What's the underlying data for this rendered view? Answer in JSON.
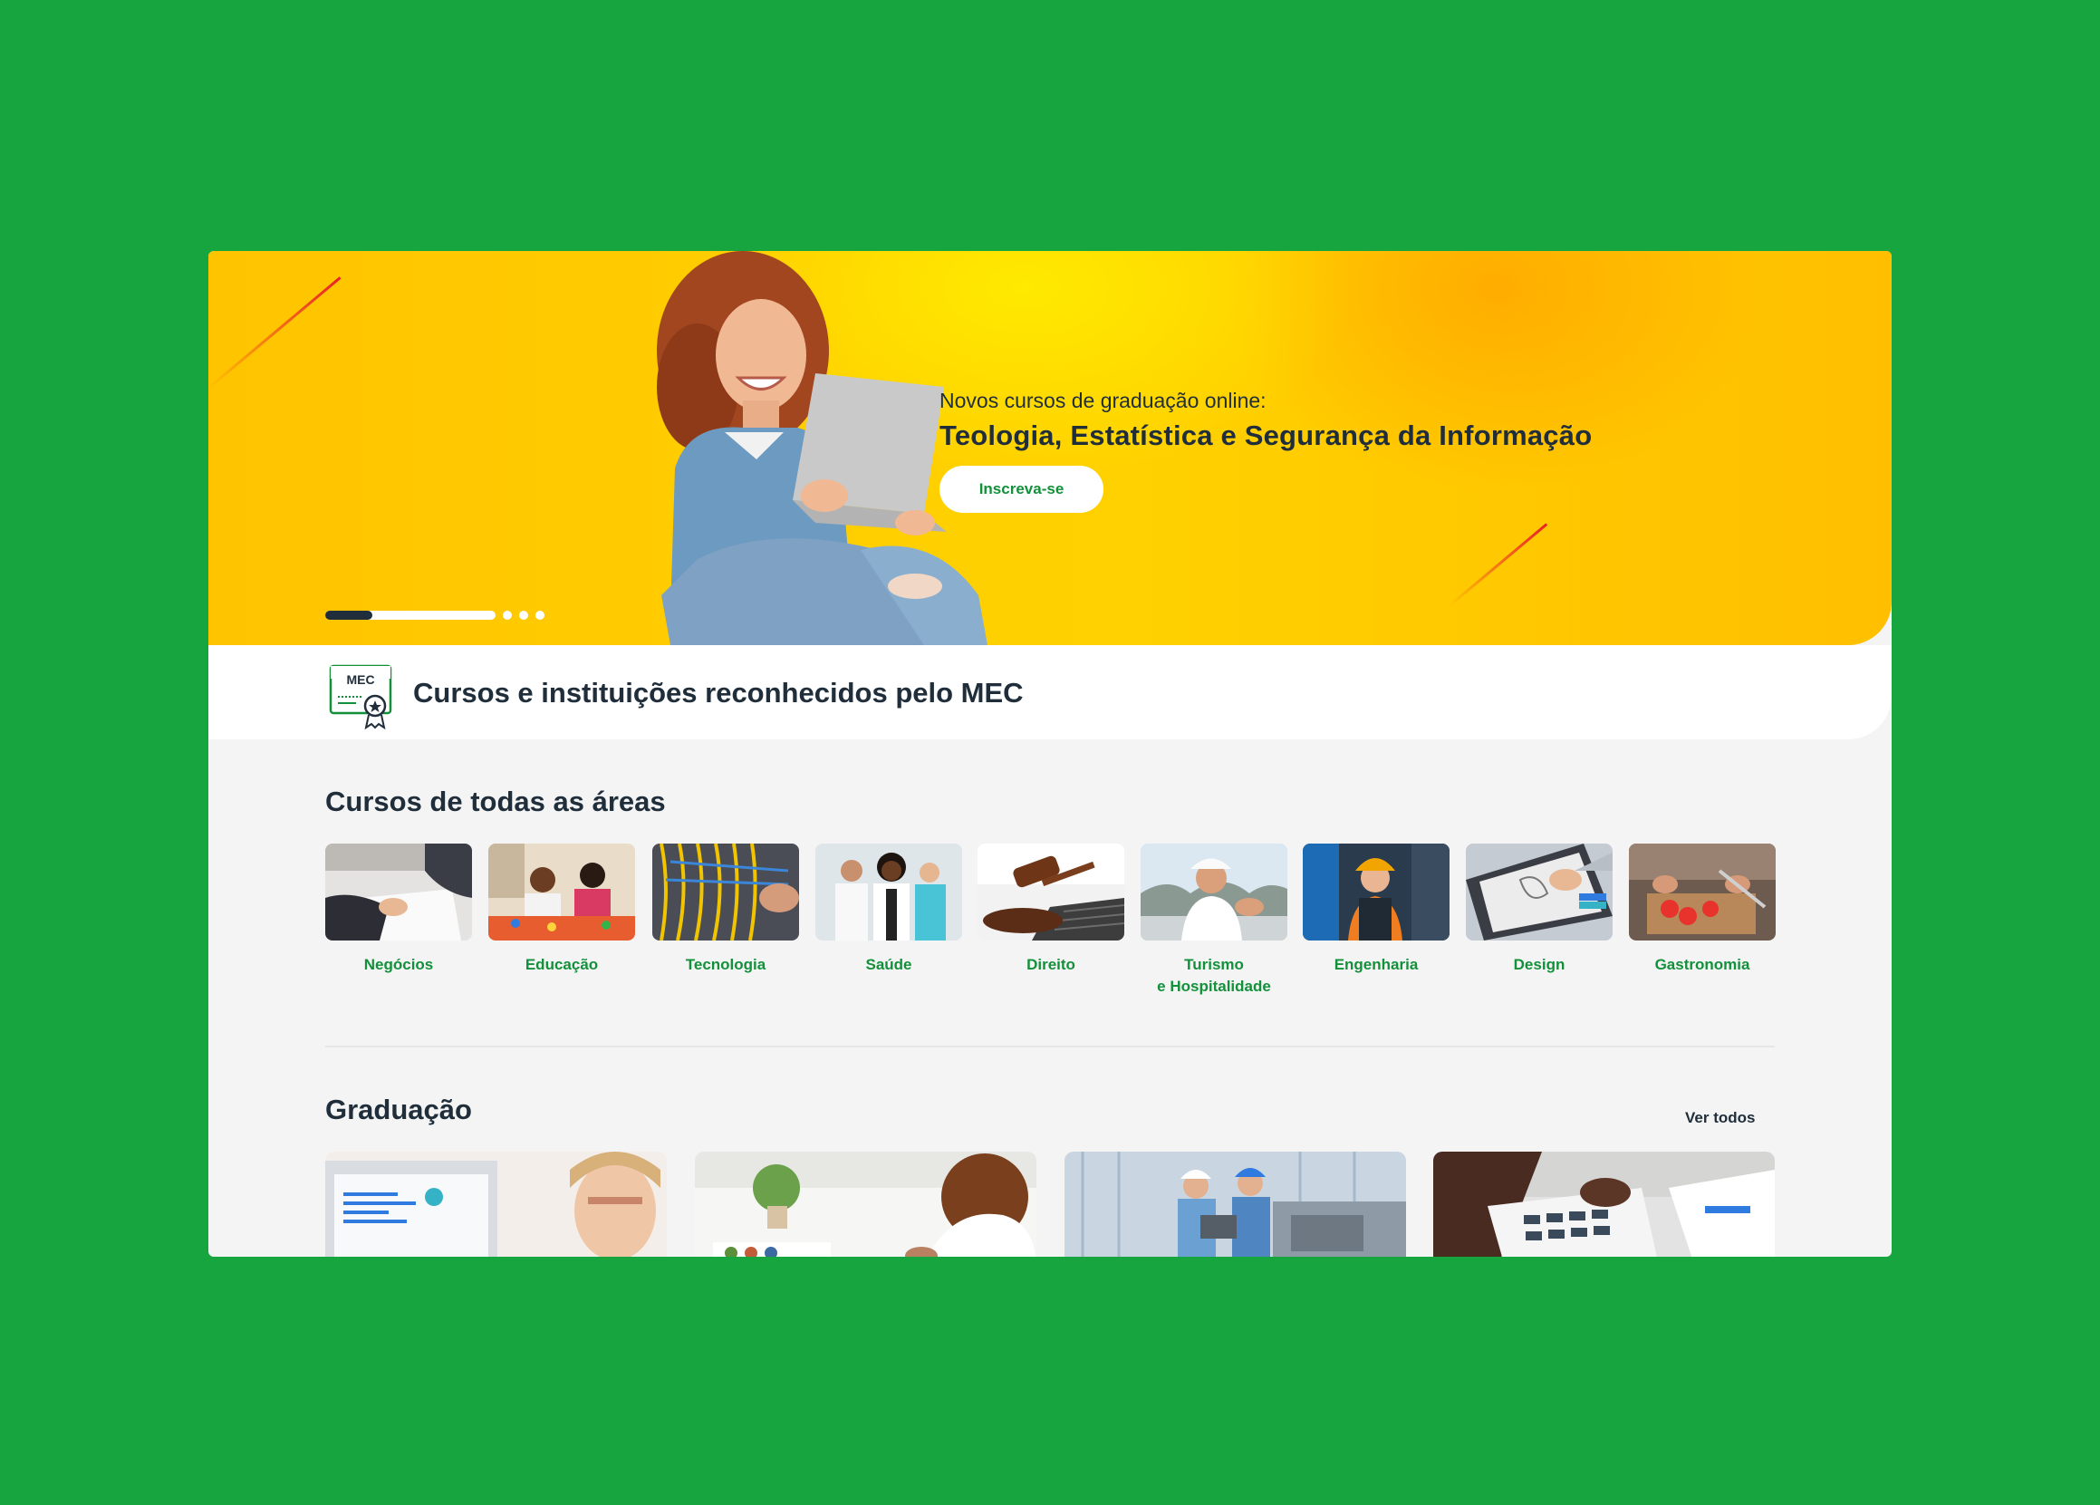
{
  "hero": {
    "subtitle": "Novos cursos de graduação online:",
    "title": "Teologia, Estatística e Segurança da Informação",
    "cta_label": "Inscreva-se",
    "slides_total": 4,
    "slide_active": 1
  },
  "mec": {
    "badge_text": "MEC",
    "text": "Cursos e instituições reconhecidos pelo MEC"
  },
  "areas": {
    "title": "Cursos de todas as áreas",
    "items": [
      {
        "label": "Negócios"
      },
      {
        "label": "Educação"
      },
      {
        "label": "Tecnologia"
      },
      {
        "label": "Saúde"
      },
      {
        "label": "Direito"
      },
      {
        "label": "Turismo\ne Hospitalidade"
      },
      {
        "label": "Engenharia"
      },
      {
        "label": "Design"
      },
      {
        "label": "Gastronomia"
      }
    ]
  },
  "graduacao": {
    "title": "Graduação",
    "see_all_label": "Ver todos"
  },
  "colors": {
    "background": "#16a53f",
    "hero_yellow": "#ffc400",
    "brand_green": "#13903a",
    "text_dark": "#1f2e3a"
  }
}
